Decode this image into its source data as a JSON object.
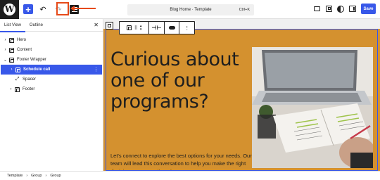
{
  "topbar": {
    "logo_letter": "W",
    "document_title": "Blog Home · Template",
    "shortcut": "Ctrl+K",
    "save_label": "Save",
    "accent_color": "#3858e9",
    "annotation_color": "#e64a19",
    "icons": [
      "wordpress-logo",
      "add-block-icon",
      "undo-icon",
      "redo-icon",
      "list-view-icon",
      "desktop-preview-icon",
      "view-page-icon",
      "styles-icon",
      "settings-icon"
    ]
  },
  "panel": {
    "tabs": [
      "List View",
      "Outline"
    ],
    "active_tab": "List View",
    "close_glyph": "✕",
    "items": [
      {
        "label": "Hero",
        "depth": 0,
        "expandable": true,
        "selected": false
      },
      {
        "label": "Content",
        "depth": 0,
        "expandable": true,
        "selected": false
      },
      {
        "label": "Footer Wrapper",
        "depth": 0,
        "expandable": true,
        "expanded": true,
        "selected": false
      },
      {
        "label": "Schedule call",
        "depth": 1,
        "expandable": true,
        "selected": true
      },
      {
        "label": "Spacer",
        "depth": 1,
        "expandable": false,
        "selected": false
      },
      {
        "label": "Footer",
        "depth": 1,
        "expandable": true,
        "selected": false
      }
    ]
  },
  "canvas": {
    "background_color": "#d4912f",
    "headline": "Curious about one of our programs?",
    "body": "Let's connect to explore the best options for your needs. Our team will lead this conversation to help you make the right decision on a commitment-"
  },
  "breadcrumbs": [
    "Template",
    "Group",
    "Group"
  ]
}
